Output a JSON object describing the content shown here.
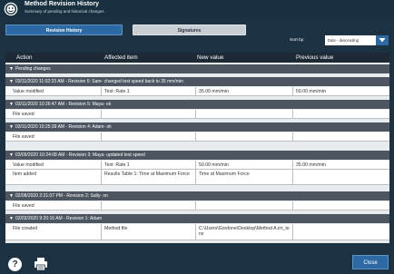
{
  "window": {
    "title": "Method Revision History",
    "subtitle": "Summary of pending and historical changes."
  },
  "tabs": [
    {
      "label": "Revision History",
      "active": true
    },
    {
      "label": "Signatures",
      "active": false
    }
  ],
  "sort": {
    "label": "Sort by:",
    "value": "Date - descending"
  },
  "table": {
    "headers": [
      "Action",
      "Affected item",
      "New value",
      "Previous value"
    ],
    "groups": [
      {
        "title": "Pending changes",
        "rows": []
      },
      {
        "title": "03/11/2020 11:02:33 AM - Revision 6: Sam- changed test speed back to 35 mm/min",
        "rows": [
          [
            "Value modified",
            "Test: Rate 1",
            "35.00 mm/min",
            "50.00 mm/min"
          ]
        ]
      },
      {
        "title": "03/11/2020 10:26:47 AM - Revision 5: Maya- ok",
        "rows": [
          [
            "File saved",
            "",
            "",
            ""
          ]
        ]
      },
      {
        "title": "03/11/2020 10:25:39 AM - Revision 4: Adam- ok",
        "rows": [
          [
            "File saved",
            "",
            "",
            ""
          ]
        ]
      },
      {
        "title": "03/09/2020 10:24:08 AM - Revision 3: Maya- updated test speed",
        "rows": [
          [
            "Value modified",
            "Test: Rate 1",
            "50.00 mm/min",
            "35.00 mm/min"
          ],
          [
            "Item added",
            "Results Table 1: Time at Maximum Force",
            "Time at Maximum Force",
            ""
          ]
        ]
      },
      {
        "title": "02/08/2020 2:31:07 PM - Revision 2: Sally- on",
        "rows": [
          [
            "File saved",
            "",
            "",
            ""
          ]
        ]
      },
      {
        "title": "02/03/2020 9:20:16 AM - Revision 1: Adam",
        "rows": [
          [
            "File created",
            "Method file",
            "C:\\Users\\Gordone\\Desktop\\Method A.im_tens",
            ""
          ]
        ]
      }
    ]
  },
  "footer": {
    "help_label": "?",
    "close_label": "Close"
  },
  "colors": {
    "background": "#1c3243",
    "accent": "#2d6aa3",
    "group_header": "#4c5560"
  },
  "icons": [
    "app-logo-icon",
    "chevron-down-icon",
    "help-icon",
    "print-icon"
  ]
}
